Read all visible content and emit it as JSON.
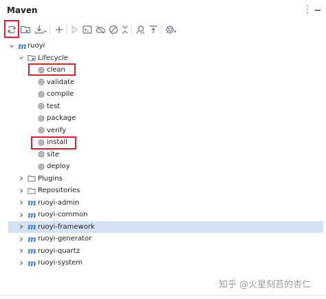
{
  "header": {
    "title": "Maven"
  },
  "toolbar": {
    "buttons": [
      {
        "name": "reload-all-projects",
        "icon": "refresh-icon"
      },
      {
        "name": "add-maven-project",
        "icon": "folder-add-icon"
      },
      {
        "name": "download-sources",
        "icon": "download-icon"
      },
      {
        "name": "add",
        "icon": "plus-icon"
      },
      {
        "name": "run",
        "icon": "play-icon"
      },
      {
        "name": "execute-goal",
        "icon": "terminal-icon"
      },
      {
        "name": "toggle-offline",
        "icon": "cloud-off-icon"
      },
      {
        "name": "skip-tests",
        "icon": "no-entry-icon"
      },
      {
        "name": "collapse",
        "icon": "collapse-icon"
      },
      {
        "name": "analyze-dependencies",
        "icon": "analyze-icon"
      },
      {
        "name": "show-dependencies",
        "icon": "align-top-icon"
      },
      {
        "name": "settings",
        "icon": "gear-icon"
      }
    ]
  },
  "tree": {
    "root": {
      "label": "ruoyi"
    },
    "lifecycle": {
      "label": "Lifecycle",
      "goals": [
        "clean",
        "validate",
        "compile",
        "test",
        "package",
        "verify",
        "install",
        "site",
        "deploy"
      ]
    },
    "folders": [
      "Plugins",
      "Repositories"
    ],
    "modules": [
      "ruoyi-admin",
      "ruoyi-common",
      "ruoyi-framework",
      "ruoyi-generator",
      "ruoyi-quartz",
      "ruoyi-system"
    ],
    "selected_module": "ruoyi-framework"
  },
  "colors": {
    "accent": "#3574f0",
    "highlight": "#e0202a",
    "selection": "#d5e1f5"
  },
  "watermark": "知乎 @火星刻苔的杏仁"
}
